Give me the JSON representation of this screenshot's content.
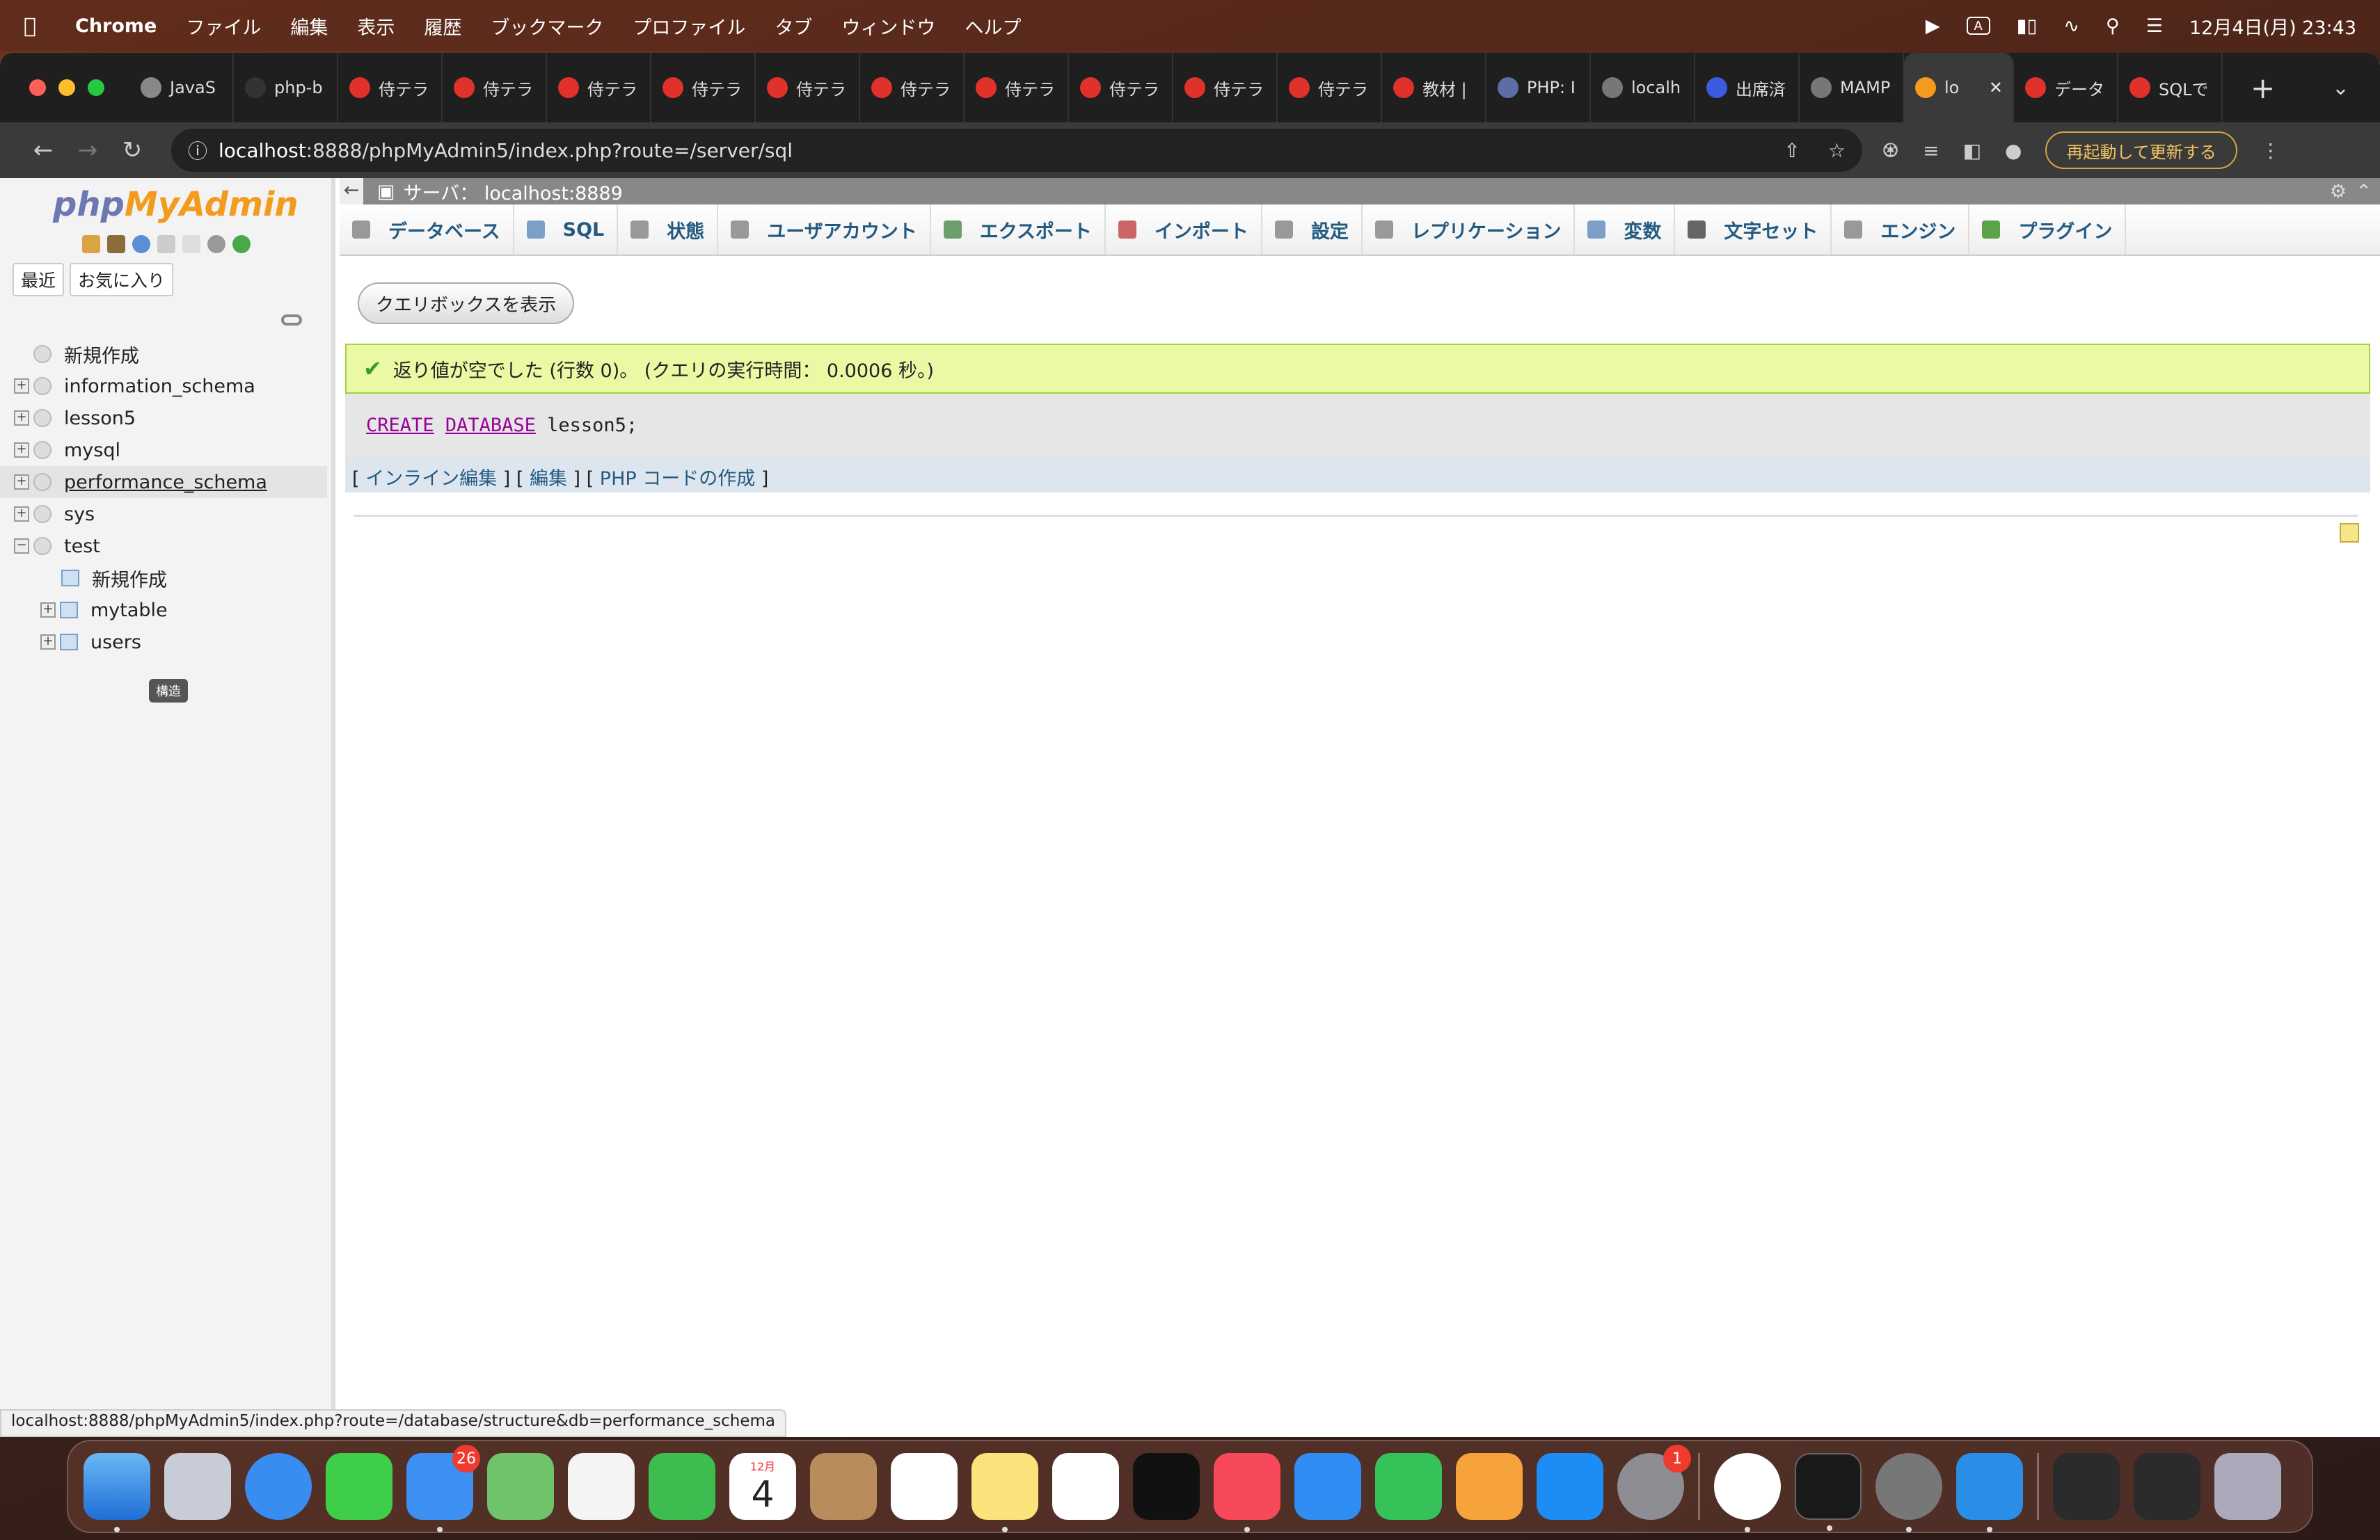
{
  "menubar": {
    "app": "Chrome",
    "items": [
      "ファイル",
      "編集",
      "表示",
      "履歴",
      "ブックマーク",
      "プロファイル",
      "タブ",
      "ウィンドウ",
      "ヘルプ"
    ],
    "input_indicator": "A",
    "datetime": "12月4日(月) 23:43"
  },
  "tabs": [
    {
      "label": "JavaS",
      "color": "#888888"
    },
    {
      "label": "php-b",
      "color": "#333333"
    },
    {
      "label": "侍テラ",
      "color": "#e0312b"
    },
    {
      "label": "侍テラ",
      "color": "#e0312b"
    },
    {
      "label": "侍テラ",
      "color": "#e0312b"
    },
    {
      "label": "侍テラ",
      "color": "#e0312b"
    },
    {
      "label": "侍テラ",
      "color": "#e0312b"
    },
    {
      "label": "侍テラ",
      "color": "#e0312b"
    },
    {
      "label": "侍テラ",
      "color": "#e0312b"
    },
    {
      "label": "侍テラ",
      "color": "#e0312b"
    },
    {
      "label": "侍テラ",
      "color": "#e0312b"
    },
    {
      "label": "侍テラ",
      "color": "#e0312b"
    },
    {
      "label": "教材 |",
      "color": "#e0312b"
    },
    {
      "label": "PHP: I",
      "color": "#5b6ea5"
    },
    {
      "label": "localh",
      "color": "#777777"
    },
    {
      "label": "出席済",
      "color": "#3d5be0"
    },
    {
      "label": "MAMP",
      "color": "#777777"
    },
    {
      "label": "lo",
      "color": "#f29b1d"
    },
    {
      "label": "データ",
      "color": "#e0312b"
    },
    {
      "label": "SQLで",
      "color": "#e0312b"
    }
  ],
  "browser": {
    "url_host": "localhost",
    "url_rest": ":8888/phpMyAdmin5/index.php?route=/server/sql",
    "update_button": "再起動して更新する"
  },
  "sidebar": {
    "logo_php": "php",
    "logo_my": "MyAdmin",
    "tab_recent": "最近",
    "tab_favorites": "お気に入り",
    "new_label": "新規作成",
    "databases": [
      "information_schema",
      "lesson5",
      "mysql",
      "performance_schema",
      "sys",
      "test"
    ],
    "test_children": [
      "新規作成",
      "mytable",
      "users"
    ],
    "tooltip": "構造"
  },
  "main": {
    "server_label": "サーバ： localhost:8889",
    "tabs": [
      "データベース",
      "SQL",
      "状態",
      "ユーザアカウント",
      "エクスポート",
      "インポート",
      "設定",
      "レプリケーション",
      "変数",
      "文字セット",
      "エンジン",
      "プラグイン"
    ],
    "query_button": "クエリボックスを表示",
    "success_msg": "返り値が空でした (行数 0)。 (クエリの実行時間： 0.0006 秒。)",
    "sql_kw1": "CREATE",
    "sql_kw2": "DATABASE",
    "sql_rest": "lesson5;",
    "action_inline": "インライン編集",
    "action_edit": "編集",
    "action_php": "PHP コードの作成"
  },
  "statusbar": "localhost:8888/phpMyAdmin5/index.php?route=/database/structure&db=performance_schema",
  "dock": {
    "calendar_month": "12月",
    "calendar_day": "4",
    "mail_badge": "26",
    "settings_badge": "1"
  }
}
